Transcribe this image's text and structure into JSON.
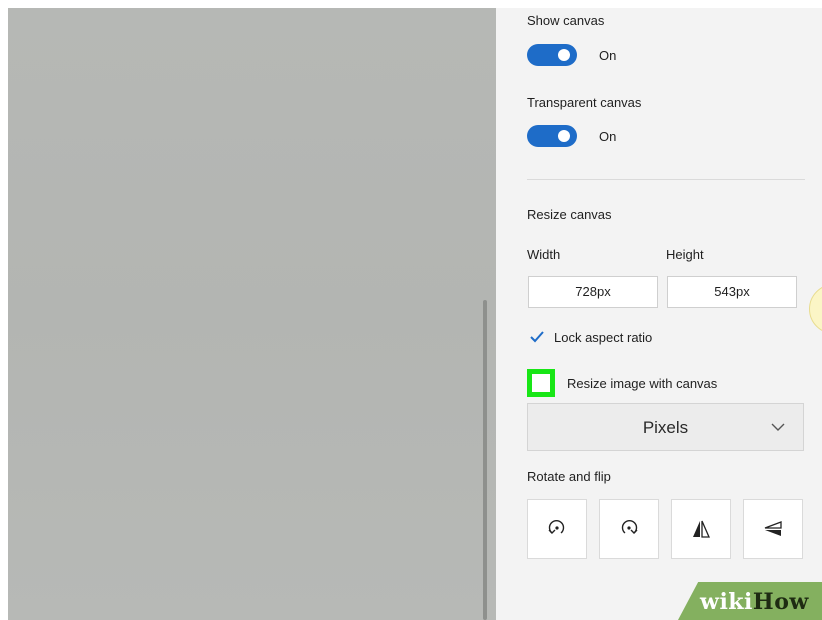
{
  "settings": {
    "show_canvas": {
      "label": "Show canvas",
      "state": "On"
    },
    "transparent_canvas": {
      "label": "Transparent canvas",
      "state": "On"
    },
    "resize_canvas": {
      "title": "Resize canvas",
      "width_label": "Width",
      "height_label": "Height",
      "width_value": "728px",
      "height_value": "543px",
      "lock_aspect_ratio": {
        "label": "Lock aspect ratio",
        "checked": true
      },
      "resize_image_with_canvas": {
        "label": "Resize image with canvas",
        "checked": false
      },
      "units": {
        "selected": "Pixels"
      }
    },
    "rotate_and_flip": {
      "title": "Rotate and flip",
      "buttons": [
        "rotate-left",
        "rotate-right",
        "flip-vertical",
        "flip-horizontal"
      ]
    }
  },
  "watermark": {
    "part1": "wiki",
    "part2": "How"
  },
  "colors": {
    "toggle_on": "#1e6cc8",
    "highlight": "#18e616",
    "panel": "#f3f3f3",
    "canvas": "#b5b7b4"
  }
}
